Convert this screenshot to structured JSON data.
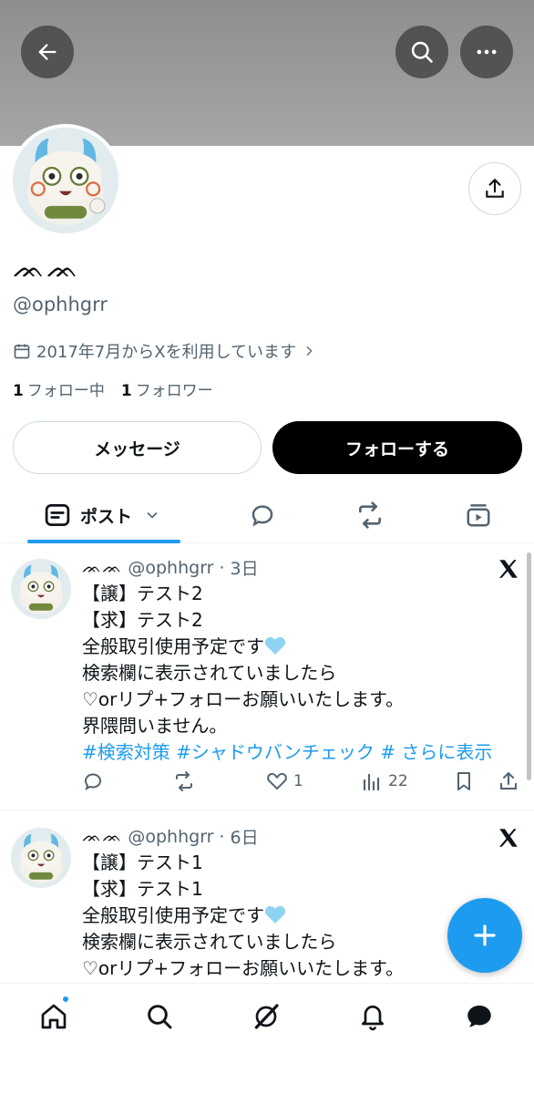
{
  "profile": {
    "display_name": "ᨏᨏ",
    "handle": "@ophhgrr",
    "joined": "2017年7月からXを利用しています",
    "following_count": "1",
    "following_label": "フォロー中",
    "followers_count": "1",
    "followers_label": "フォロワー"
  },
  "buttons": {
    "message": "メッセージ",
    "follow": "フォローする"
  },
  "tabs": {
    "posts_label": "ポスト"
  },
  "posts": [
    {
      "name": "ᨏᨏ",
      "handle": "@ophhgrr",
      "time": "3日",
      "lines": [
        "【譲】テスト2",
        "【求】テスト2",
        "全般取引使用予定です",
        "検索欄に表示されていましたら",
        "♡orリプ+フォローお願いいたします。",
        "界隈問いません。"
      ],
      "hashtags": "#検索対策 #シャドウバンチェック # さらに表示",
      "likes": "1",
      "views": "22"
    },
    {
      "name": "ᨏᨏ",
      "handle": "@ophhgrr",
      "time": "6日",
      "lines": [
        "【譲】テスト1",
        "【求】テスト1",
        "全般取引使用予定です",
        "検索欄に表示されていましたら",
        "♡orリプ+フォローお願いいたします。"
      ]
    }
  ],
  "colors": {
    "accent": "#1d9bf0",
    "text": "#0f1419",
    "secondary": "#536471"
  },
  "icons": {
    "top": [
      "back-arrow-icon",
      "search-icon",
      "more-icon"
    ],
    "nav": [
      "home-icon",
      "search-icon",
      "grok-icon",
      "notifications-icon",
      "messages-icon"
    ]
  }
}
